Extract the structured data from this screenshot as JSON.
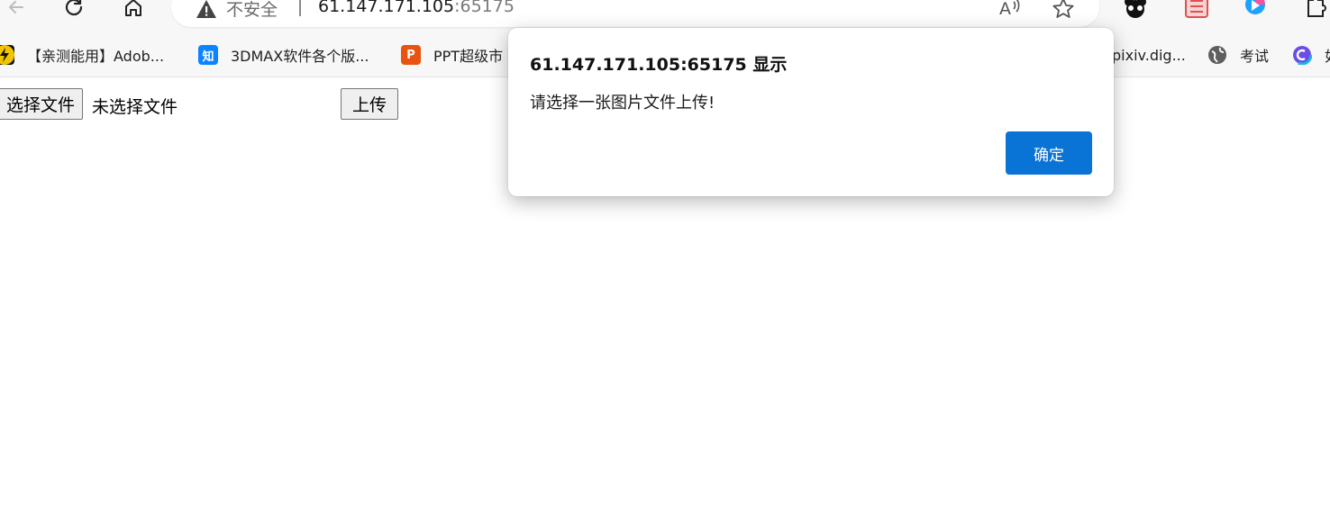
{
  "toolbar": {
    "back_icon": "back-arrow-icon",
    "reload_icon": "reload-icon",
    "home_icon": "home-icon"
  },
  "omnibox": {
    "security_icon": "warning-triangle-icon",
    "security_label": "不安全",
    "url_host": "61.147.171.105",
    "url_port": ":65175",
    "read_aloud_icon": "read-aloud-icon",
    "favorite_icon": "star-icon"
  },
  "extensions": [
    "bear-icon",
    "puzzle-game-icon",
    "copilot-icon",
    "extensions-puzzle-icon"
  ],
  "bookmarks": [
    {
      "icon": "lightning-icon",
      "label": "【亲测能用】Adob...",
      "color": "#f2c400"
    },
    {
      "icon": "zhihu-icon",
      "label": "3DMAX软件各个版...",
      "glyph": "知",
      "color": "#0a84ff"
    },
    {
      "icon": "ppt-icon",
      "label": "PPT超级市",
      "glyph": "P",
      "color": "#e8540f"
    },
    {
      "icon": "pixiv-icon",
      "label": "pixiv.dig...",
      "color": "#ffffff"
    },
    {
      "icon": "globe-icon",
      "label": "考试",
      "color": "#555555"
    },
    {
      "icon": "edge-copilot-icon",
      "label": "如",
      "color": "#6b4de6"
    }
  ],
  "page": {
    "choose_file_label": "选择文件",
    "file_status": "未选择文件",
    "upload_label": "上传"
  },
  "dialog": {
    "title": "61.147.171.105:65175 显示",
    "message": "请选择一张图片文件上传!",
    "ok_label": "确定",
    "ok_color": "#0a74d6"
  }
}
